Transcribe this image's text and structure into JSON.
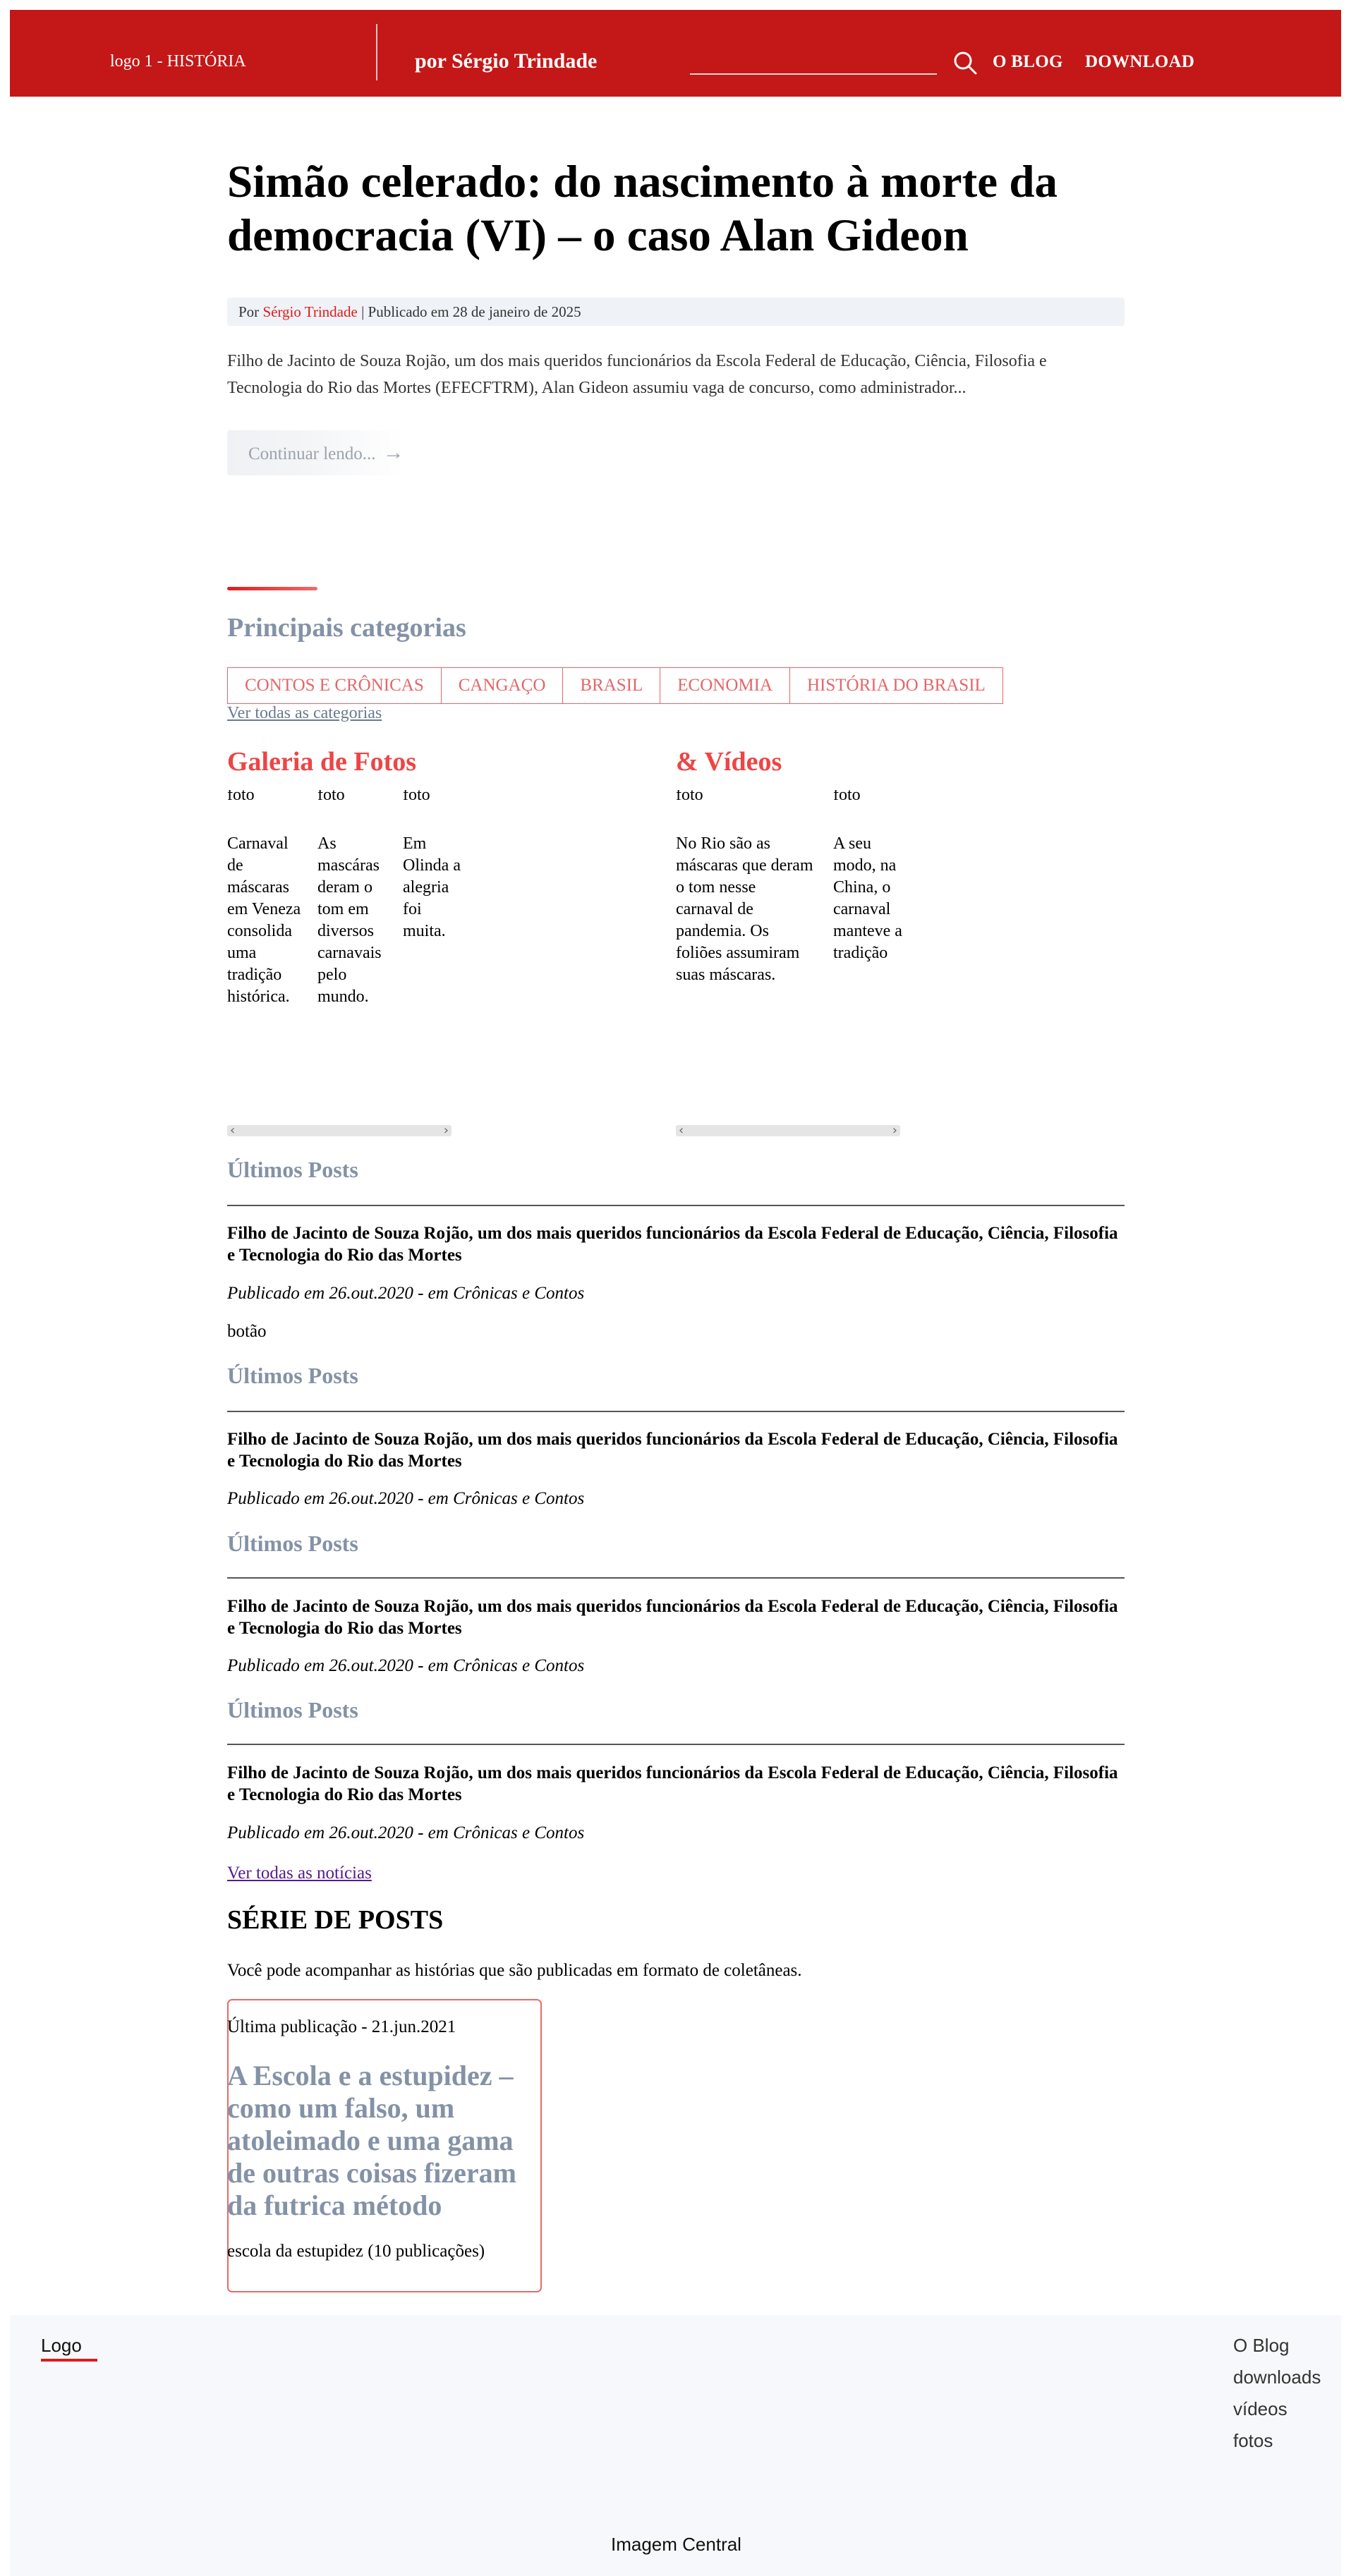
{
  "header": {
    "logo_text": "logo 1 - HISTÓRIA",
    "author": "por Sérgio Trindade",
    "search_value": "",
    "nav": [
      "O BLOG",
      "DOWNLOAD"
    ]
  },
  "post": {
    "title": "Simão celerado: do nascimento à morte da democracia (VI) – o caso Alan Gideon",
    "meta_prefix": "Por",
    "meta_author": "Sérgio Trindade",
    "meta_date": "| Publicado em 28 de janeiro de 2025",
    "excerpt": "Filho de Jacinto de Souza Rojão, um dos mais queridos funcionários da Escola Federal de Educação, Ciência, Filosofia e Tecnologia do Rio das Mortes (EFECFTRM), Alan Gideon assumiu vaga de concurso, como administrador...",
    "read_more": "Continuar lendo...",
    "read_more_arrow": "→"
  },
  "categories": {
    "heading": "Principais categorias",
    "items": [
      "CONTOS E CRÔNICAS",
      "CANGAÇO",
      "BRASIL",
      "ECONOMIA",
      "HISTÓRIA DO BRASIL"
    ],
    "all_link": "Ver todas as categorias"
  },
  "gallery_photos": {
    "heading": "Galeria de Fotos",
    "items": [
      {
        "label": "foto",
        "caption": "Carnaval de máscaras em Veneza consolida uma tradição histórica."
      },
      {
        "label": "foto",
        "caption": "As mascáras deram o tom em diversos carnavais pelo mundo."
      },
      {
        "label": "foto",
        "caption": "Em Olinda a alegria foi muita."
      }
    ]
  },
  "gallery_videos": {
    "heading": "& Vídeos",
    "items": [
      {
        "label": "foto",
        "caption": "No Rio são as máscaras que deram o tom nesse carnaval de pandemia. Os foliões assumiram suas máscaras."
      },
      {
        "label": "foto",
        "caption": "A seu modo, na China, o carnaval manteve a tradição"
      }
    ]
  },
  "latest_posts": {
    "blocks": [
      {
        "heading": "Últimos Posts",
        "title": "Filho de Jacinto de Souza Rojão, um dos mais queridos funcionários da Escola Federal de Educação, Ciência, Filosofia e Tecnologia do Rio das Mortes",
        "meta": "Publicado em 26.out.2020 - em Crônicas e Contos"
      },
      {
        "heading": "Últimos Posts",
        "title": "Filho de Jacinto de Souza Rojão, um dos mais queridos funcionários da Escola Federal de Educação, Ciência, Filosofia e Tecnologia do Rio das Mortes",
        "meta": "Publicado em 26.out.2020 - em Crônicas e Contos"
      },
      {
        "heading": "Últimos Posts",
        "title": "Filho de Jacinto de Souza Rojão, um dos mais queridos funcionários da Escola Federal de Educação, Ciência, Filosofia e Tecnologia do Rio das Mortes",
        "meta": "Publicado em 26.out.2020 - em Crônicas e Contos"
      },
      {
        "heading": "Últimos Posts",
        "title": "Filho de Jacinto de Souza Rojão, um dos mais queridos funcionários da Escola Federal de Educação, Ciência, Filosofia e Tecnologia do Rio das Mortes",
        "meta": "Publicado em 26.out.2020 - em Crônicas e Contos"
      }
    ],
    "button_text": "botão",
    "all_link": "Ver todas as notícias"
  },
  "series": {
    "heading": "SÉRIE DE POSTS",
    "intro": "Você pode acompanhar as histórias que são publicadas em formato de coletâneas.",
    "last_published": "Última publicação - 21.jun.2021",
    "card_title": "A Escola e a estupidez – como um falso, um atoleimado e uma gama de outras coisas fizeram da futrica método",
    "count": "escola da estupidez (10 publicações)"
  },
  "footer": {
    "logo": "Logo",
    "links": [
      "O Blog",
      "downloads",
      "vídeos",
      "fotos"
    ],
    "center": "Imagem Central"
  },
  "colors": {
    "brand_red": "#c41717",
    "accent_red": "#ef4444",
    "muted_heading": "#8492a6"
  }
}
